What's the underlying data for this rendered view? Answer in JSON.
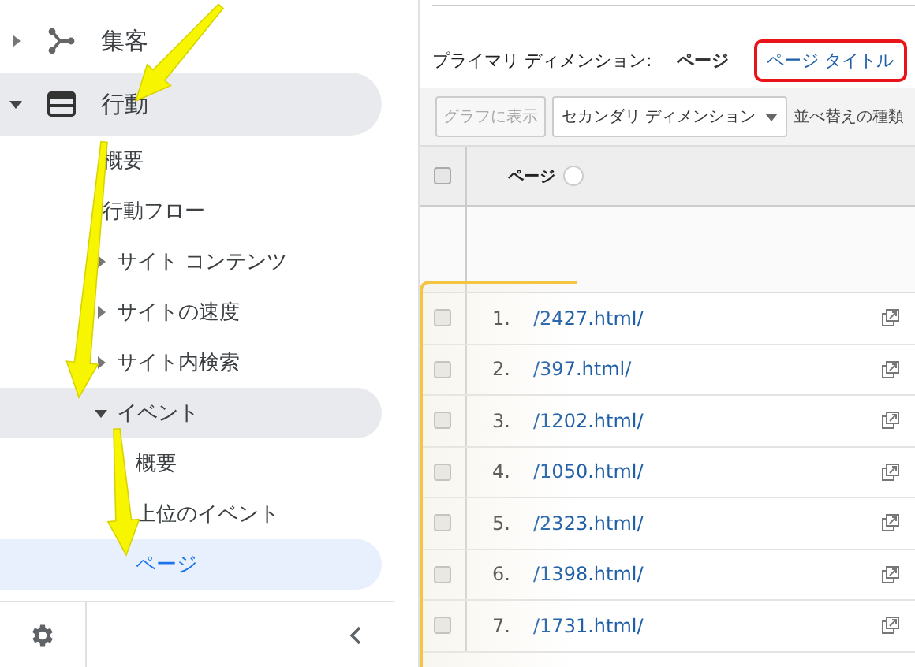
{
  "sidebar": {
    "items": [
      {
        "label": "集客",
        "kind": "acquisition",
        "expanded": false,
        "selected": false
      },
      {
        "label": "行動",
        "kind": "behavior",
        "expanded": true,
        "selected": false,
        "children": [
          {
            "label": "概要",
            "selected": false
          },
          {
            "label": "行動フロー",
            "selected": false
          },
          {
            "label": "サイト コンテンツ",
            "expanded": false,
            "selected": false
          },
          {
            "label": "サイトの速度",
            "expanded": false,
            "selected": false
          },
          {
            "label": "サイト内検索",
            "expanded": false,
            "selected": false
          },
          {
            "label": "イベント",
            "expanded": true,
            "selected": false,
            "children": [
              {
                "label": "概要",
                "selected": false
              },
              {
                "label": "上位のイベント",
                "selected": false
              },
              {
                "label": "ページ",
                "selected": true
              }
            ]
          }
        ]
      }
    ]
  },
  "annotations": [
    {
      "kind": "arrow"
    },
    {
      "kind": "arrow"
    },
    {
      "kind": "arrow"
    }
  ],
  "primary_dimension": {
    "label": "プライマリ ディメンション:",
    "options": [
      {
        "label": "ページ",
        "selected": true,
        "highlighted": false
      },
      {
        "label": "ページ タイトル",
        "selected": false,
        "highlighted": true
      }
    ]
  },
  "toolbar": {
    "chart_button": {
      "label": "グラフに表示",
      "disabled": true
    },
    "secondary_dimension": "セカンダリ ディメンション",
    "sort_label": "並べ替えの種類"
  },
  "table": {
    "column": "ページ",
    "header_checked": false,
    "rows": [
      {
        "index": "1.",
        "page": "/2427.html/",
        "checked": false
      },
      {
        "index": "2.",
        "page": "/397.html/",
        "checked": false
      },
      {
        "index": "3.",
        "page": "/1202.html/",
        "checked": false
      },
      {
        "index": "4.",
        "page": "/1050.html/",
        "checked": false
      },
      {
        "index": "5.",
        "page": "/2323.html/",
        "checked": false
      },
      {
        "index": "6.",
        "page": "/1398.html/",
        "checked": false
      },
      {
        "index": "7.",
        "page": "/1731.html/",
        "checked": false
      }
    ]
  }
}
